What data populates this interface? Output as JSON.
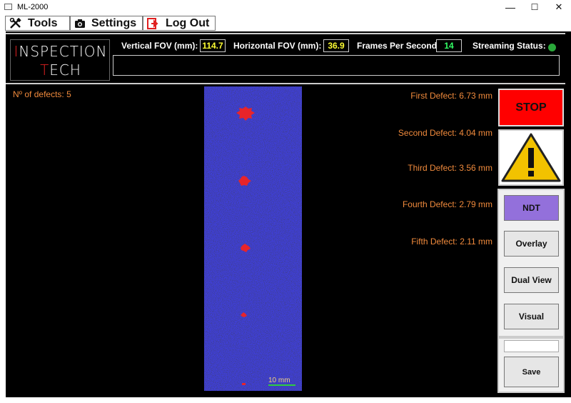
{
  "window": {
    "title": "ML-2000",
    "minimize": "—",
    "maximize": "☐",
    "close": "✕"
  },
  "menu": {
    "tools": "Tools",
    "settings": "Settings",
    "logout": "Log Out"
  },
  "logo": {
    "line1_first": "I",
    "line1_rest": "NSPECTION",
    "line2_first": "T",
    "line2_rest": "ECH"
  },
  "header": {
    "vertical_fov_label": "Vertical FOV (mm):",
    "vertical_fov_value": "114.7",
    "horizontal_fov_label": "Horizontal FOV (mm):",
    "horizontal_fov_value": "36.9",
    "fps_label": "Frames Per Second:",
    "fps_value": "14",
    "streaming_label": "Streaming Status:",
    "streaming_color": "#2aa83a",
    "value_color_yellow": "#ffff33",
    "value_color_green": "#33ff66"
  },
  "defects": {
    "count_label": "Nº of defects: 5",
    "items": [
      "First Defect: 6.73 mm",
      "Second Defect: 4.04 mm",
      "Third Defect: 3.56 mm",
      "Fourth Defect: 2.79 mm",
      "Fifth Defect: 2.11 mm"
    ],
    "color": "#f08a3c"
  },
  "scan": {
    "scale_label": "10 mm"
  },
  "controls": {
    "stop": "STOP",
    "warning_icon": "warning-triangle-icon",
    "modes": [
      "NDT",
      "Overlay",
      "Dual View",
      "Visual"
    ],
    "active_mode": "NDT",
    "save": "Save",
    "save_input_value": ""
  }
}
